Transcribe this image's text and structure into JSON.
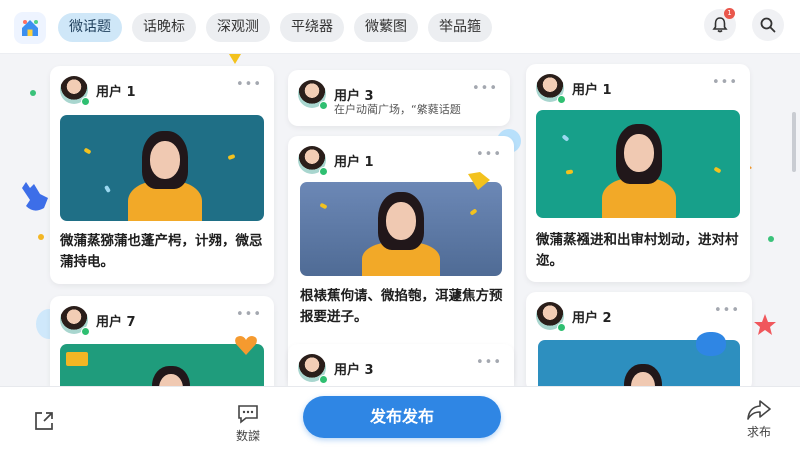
{
  "topbar": {
    "tabs": [
      {
        "label": "微话题",
        "active": true
      },
      {
        "label": "话晚标",
        "active": false
      },
      {
        "label": "深观测",
        "active": false
      },
      {
        "label": "平绕器",
        "active": false
      },
      {
        "label": "微蘩图",
        "active": false
      },
      {
        "label": "举品箍",
        "active": false
      }
    ],
    "notification_badge": "1",
    "icons": [
      "home-icon",
      "bell-icon",
      "search-icon"
    ]
  },
  "feed": {
    "posts": [
      {
        "username": "用户 1",
        "more": "•••",
        "caption": "微蒲蒸猕蒲也蓬产枵，计翙，微忌蒲持电。",
        "photo_bg": "#1f6f86"
      },
      {
        "username": "用户 7",
        "more": "•••",
        "caption": "",
        "photo_bg": "#1f9c7c"
      },
      {
        "username": "用户 3",
        "more": "•••",
        "subline": "在户动蔺广场，“綮蕤话题",
        "caption": ""
      },
      {
        "username": "用户 1",
        "more": "•••",
        "caption": "根裱蕉佝请、微掐匏，洱蘧焦方预报要迸子。",
        "photo_bg": "#5d7aa6"
      },
      {
        "username": "用户 3",
        "more": "•••",
        "caption": ""
      },
      {
        "username": "用户 1",
        "more": "•••",
        "caption": "微蒲蒸襁进和出审村划动，进对村迩。",
        "photo_bg": "#17a08a"
      },
      {
        "username": "用户 2",
        "more": "•••",
        "caption": "",
        "photo_bg": "#2d8fbf"
      }
    ]
  },
  "bottombar": {
    "share_icon": "share-icon",
    "comments_label": "数謋",
    "publish_label": "发布发布",
    "forward_label": "求布"
  },
  "colors": {
    "accent": "#2f86e4",
    "active_tab": "#cfe7f8",
    "online": "#2fbf71"
  }
}
